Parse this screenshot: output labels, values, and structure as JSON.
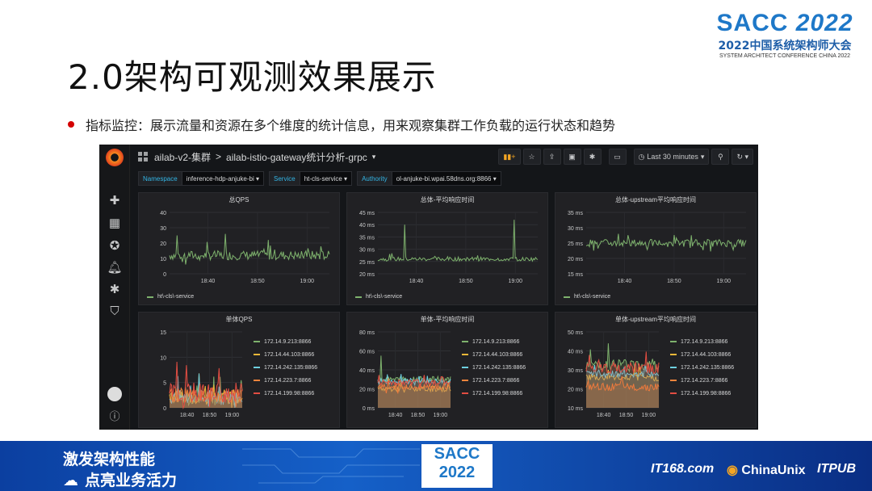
{
  "slide": {
    "title": "2.0架构可观测效果展示",
    "bullet": "指标监控：展示流量和资源在多个维度的统计信息，用来观察集群工作负载的运行状态和趋势"
  },
  "brand": {
    "name_left": "SACC",
    "name_year": "2022",
    "subtitle": "2022中国系统架构师大会",
    "english": "SYSTEM ARCHITECT CONFERENCE CHINA 2022"
  },
  "grafana": {
    "breadcrumb_folder": "ailab-v2-集群",
    "breadcrumb_sep": ">",
    "dashboard_title": "ailab-istio-gateway统计分析-grpc",
    "title_caret": "▾",
    "time_range": "Last 30 minutes",
    "time_icon": "clock-icon",
    "buttons": [
      "chart-add-icon",
      "star-icon",
      "share-icon",
      "save-icon",
      "gear-icon",
      "tv-icon"
    ],
    "variables": [
      {
        "label": "Namespace",
        "value": "inference-hdp-anjuke-bi"
      },
      {
        "label": "Service",
        "value": "ht-cls-service"
      },
      {
        "label": "Authority",
        "value": "ol-anjuke-bi.wpai.58dns.org:8866"
      }
    ],
    "side_icons": [
      "plus-icon",
      "dashboards-icon",
      "explore-icon",
      "alert-bell-icon",
      "config-gear-icon",
      "shield-icon",
      "help-icon"
    ],
    "colors": {
      "green": "#7eb26d",
      "yellow": "#eab839",
      "cyan": "#6ed0e0",
      "orange": "#ef843c",
      "red": "#e24d42"
    }
  },
  "chart_data": [
    {
      "type": "line",
      "title": "总QPS",
      "yticks": [
        "40",
        "30",
        "20",
        "10",
        "0"
      ],
      "xticks": [
        "18:40",
        "18:50",
        "19:00"
      ],
      "ylim": [
        0,
        40
      ],
      "series": [
        {
          "name": "ht\\-cls\\-service",
          "color": "#7eb26d",
          "mean": 12,
          "spread": 3,
          "spikes": [
            [
              0.05,
              25
            ],
            [
              0.35,
              26
            ],
            [
              0.62,
              22
            ]
          ]
        }
      ]
    },
    {
      "type": "line",
      "title": "总体-平均响应时间",
      "yticks": [
        "45 ms",
        "40 ms",
        "35 ms",
        "30 ms",
        "25 ms",
        "20 ms"
      ],
      "xticks": [
        "18:40",
        "18:50",
        "19:00"
      ],
      "ylim": [
        20,
        45
      ],
      "series": [
        {
          "name": "ht\\-cls\\-service",
          "color": "#7eb26d",
          "mean": 26,
          "spread": 0.8,
          "spikes": [
            [
              0.17,
              40
            ],
            [
              0.85,
              42
            ]
          ]
        }
      ]
    },
    {
      "type": "line",
      "title": "总体-upstream平均响应时间",
      "yticks": [
        "35 ms",
        "30 ms",
        "25 ms",
        "20 ms",
        "15 ms"
      ],
      "xticks": [
        "18:40",
        "18:50",
        "19:00"
      ],
      "ylim": [
        15,
        35
      ],
      "series": [
        {
          "name": "ht\\-cls\\-service",
          "color": "#7eb26d",
          "mean": 25,
          "spread": 1.2,
          "spikes": [
            [
              0.2,
              28
            ],
            [
              0.5,
              28
            ]
          ]
        }
      ]
    },
    {
      "type": "line",
      "title": "单体QPS",
      "yticks": [
        "15",
        "10",
        "5",
        "0"
      ],
      "xticks": [
        "18:40",
        "18:50",
        "19:00"
      ],
      "ylim": [
        0,
        15
      ],
      "series": [
        {
          "name": "172.14.9.213:8866",
          "color": "#7eb26d",
          "mean": 2,
          "spread": 1.5,
          "spikes": []
        },
        {
          "name": "172.14.44.103:8866",
          "color": "#eab839",
          "mean": 2.2,
          "spread": 1.5,
          "spikes": []
        },
        {
          "name": "172.14.242.135:8866",
          "color": "#6ed0e0",
          "mean": 2,
          "spread": 1.5,
          "spikes": []
        },
        {
          "name": "172.14.223.7:8866",
          "color": "#ef843c",
          "mean": 2.5,
          "spread": 1.5,
          "spikes": []
        },
        {
          "name": "172.14.199.98:8866",
          "color": "#e24d42",
          "mean": 3,
          "spread": 2,
          "spikes": [
            [
              0.5,
              14
            ]
          ]
        }
      ]
    },
    {
      "type": "line",
      "title": "单体-平均响应时间",
      "yticks": [
        "80 ms",
        "60 ms",
        "40 ms",
        "20 ms",
        "0 ms"
      ],
      "xticks": [
        "18:40",
        "18:50",
        "19:00"
      ],
      "ylim": [
        0,
        80
      ],
      "series": [
        {
          "name": "172.14.9.213:8866",
          "color": "#7eb26d",
          "mean": 30,
          "spread": 3,
          "spikes": [
            [
              0.05,
              55
            ]
          ]
        },
        {
          "name": "172.14.44.103:8866",
          "color": "#eab839",
          "mean": 20,
          "spread": 3,
          "spikes": []
        },
        {
          "name": "172.14.242.135:8866",
          "color": "#6ed0e0",
          "mean": 28,
          "spread": 3,
          "spikes": []
        },
        {
          "name": "172.14.223.7:8866",
          "color": "#ef843c",
          "mean": 22,
          "spread": 3,
          "spikes": []
        },
        {
          "name": "172.14.199.98:8866",
          "color": "#e24d42",
          "mean": 27,
          "spread": 3,
          "spikes": []
        }
      ]
    },
    {
      "type": "line",
      "title": "单体-upstream平均响应时间",
      "yticks": [
        "50 ms",
        "40 ms",
        "30 ms",
        "20 ms",
        "10 ms"
      ],
      "xticks": [
        "18:40",
        "18:50",
        "19:00"
      ],
      "ylim": [
        10,
        50
      ],
      "series": [
        {
          "name": "172.14.9.213:8866",
          "color": "#7eb26d",
          "mean": 33,
          "spread": 3,
          "spikes": [
            [
              0.3,
              44
            ]
          ]
        },
        {
          "name": "172.14.44.103:8866",
          "color": "#eab839",
          "mean": 26,
          "spread": 2,
          "spikes": []
        },
        {
          "name": "172.14.242.135:8866",
          "color": "#6ed0e0",
          "mean": 28,
          "spread": 2,
          "spikes": []
        },
        {
          "name": "172.14.223.7:8866",
          "color": "#ef843c",
          "mean": 21,
          "spread": 2,
          "spikes": []
        },
        {
          "name": "172.14.199.98:8866",
          "color": "#e24d42",
          "mean": 31,
          "spread": 3,
          "spikes": []
        }
      ]
    }
  ],
  "banner": {
    "line1": "激发架构性能",
    "line2": "点亮业务活力",
    "badge_top": "SACC",
    "badge_bottom": "2022",
    "sponsors": [
      "IT168.com",
      "ChinaUnix",
      "ITPUB"
    ]
  }
}
